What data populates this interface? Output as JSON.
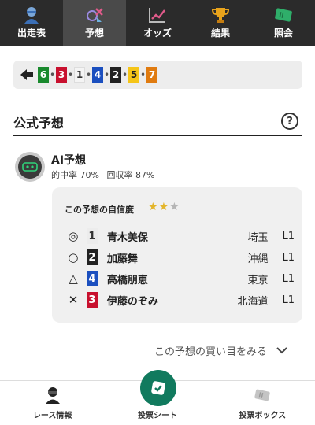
{
  "tabs": [
    {
      "label": "出走表",
      "icon": "jockey-icon",
      "active": false
    },
    {
      "label": "予想",
      "icon": "prediction-icon",
      "active": true
    },
    {
      "label": "オッズ",
      "icon": "chart-icon",
      "active": false
    },
    {
      "label": "結果",
      "icon": "trophy-icon",
      "active": false
    },
    {
      "label": "照会",
      "icon": "ticket-icon",
      "active": false
    }
  ],
  "order": {
    "numbers": [
      {
        "n": "6",
        "bg": "#1a8a2e",
        "fg": "#ffffff"
      },
      {
        "n": "3",
        "bg": "#c8102e",
        "fg": "#ffffff"
      },
      {
        "n": "1",
        "bg": "#f4f4f4",
        "fg": "#333333"
      },
      {
        "n": "4",
        "bg": "#1b4fbf",
        "fg": "#ffffff"
      },
      {
        "n": "2",
        "bg": "#222222",
        "fg": "#ffffff"
      },
      {
        "n": "5",
        "bg": "#f5c518",
        "fg": "#222222"
      },
      {
        "n": "7",
        "bg": "#e07b10",
        "fg": "#ffffff"
      }
    ]
  },
  "section": {
    "title": "公式予想",
    "help": "?"
  },
  "ai": {
    "name": "AI予想",
    "hit_rate": "的中率 70%",
    "return_rate": "回収率 87%"
  },
  "card": {
    "confidence_label": "この予想の自信度",
    "stars": 2,
    "stars_max": 3,
    "rows": [
      {
        "mark": "◎",
        "num": "1",
        "num_bg": "#ececec",
        "num_fg": "#333333",
        "name": "青木美保",
        "pref": "埼玉",
        "cls": "L1"
      },
      {
        "mark": "○",
        "num": "2",
        "num_bg": "#222222",
        "num_fg": "#ffffff",
        "name": "加藤舞",
        "pref": "沖縄",
        "cls": "L1"
      },
      {
        "mark": "△",
        "num": "4",
        "num_bg": "#1b4fbf",
        "num_fg": "#ffffff",
        "name": "高橋朋恵",
        "pref": "東京",
        "cls": "L1"
      },
      {
        "mark": "✕",
        "num": "3",
        "num_bg": "#c8102e",
        "num_fg": "#ffffff",
        "name": "伊藤のぞみ",
        "pref": "北海道",
        "cls": "L1"
      }
    ]
  },
  "buy_link": "この予想の買い目をみる",
  "bottom": {
    "race_info": "レース情報",
    "vote_sheet": "投票シート",
    "vote_box": "投票ボックス"
  },
  "colors": {
    "accent": "#117a5e",
    "header_bg": "#2b2b2b"
  }
}
